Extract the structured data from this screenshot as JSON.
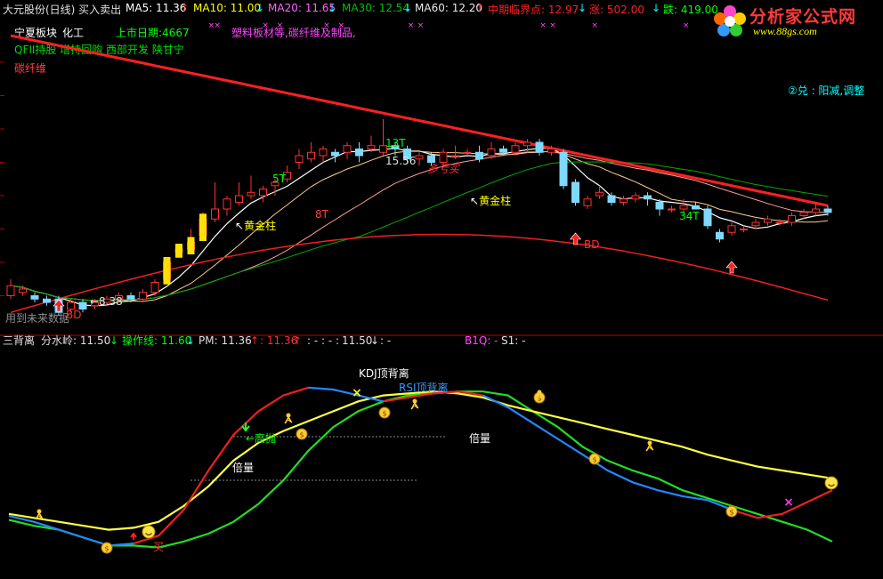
{
  "header": {
    "title": "大元股份(日线) 买入卖出",
    "ma5": "MA5: 11.36",
    "ma10": "MA10: 11.00",
    "ma20": "MA20: 11.65",
    "ma30": "MA30: 12.54",
    "ma60": "MA60: 12.20",
    "critical": "中期临界点: 12.97",
    "rise": "涨: 502.00",
    "fall": "跌: 419.00",
    "up_arrow": "↑",
    "down_arrow": "↓",
    "colors": {
      "ma5": "#ffffff",
      "ma10": "#ffff00",
      "ma20": "#ff66ff",
      "ma30": "#00ff00",
      "ma60": "#ff9999",
      "critical": "#ff2020"
    }
  },
  "logo": {
    "name": "分析家公式网",
    "url": "www.88gs.com"
  },
  "info": {
    "sector": "宁夏板块",
    "industry": "化工",
    "listing": "上市日期:4667",
    "product": "塑料板材等,碳纤维及制品,",
    "concepts": "QFII持股 增持回购 西部开发 陕甘宁",
    "concept2": "碳纤维",
    "right_note": "②兑 : 阳减,调整",
    "future_note": "用到未来数据"
  },
  "price_annotations": {
    "low": "←8.38",
    "high": "15.56",
    "t13": "13T",
    "t5": "5T",
    "t8": "8T",
    "t34": "34T",
    "duo": "多亏买",
    "golden1": "黄金柱",
    "golden2": "黄金柱",
    "bd1": "BD",
    "bd2": "BD"
  },
  "indicator": {
    "name": "三背离",
    "fenshui": "分水岭: 11.50",
    "caozuo": "操作线: 11.60",
    "pm": "PM: 11.36",
    "v1136": ": 11.36",
    "dashes": ": - : - :",
    "v1150": "11.50",
    "colon": ": -",
    "b1q": "B1Q: -",
    "s1": "S1: -",
    "kdj": "KDJ顶背离",
    "rsi": "RSI顶背离",
    "gaopao": "←高抛",
    "beiliang1": "倍量",
    "beiliang2": "倍量",
    "buy": "买"
  },
  "chart_data": [
    {
      "type": "candlestick",
      "title": "大元股份(日线)",
      "ylim": [
        8.0,
        16.8
      ],
      "series_notes": [
        "MA5",
        "MA10",
        "MA20",
        "MA30",
        "MA60",
        "中期临界点"
      ],
      "candles": [
        [
          9.0,
          9.3,
          9.5,
          8.9
        ],
        [
          9.1,
          9.2,
          9.3,
          9.0
        ],
        [
          9.0,
          8.9,
          9.1,
          8.8
        ],
        [
          8.9,
          8.8,
          9.0,
          8.7
        ],
        [
          8.9,
          8.5,
          9.0,
          8.4
        ],
        [
          8.6,
          8.8,
          8.9,
          8.5
        ],
        [
          8.8,
          8.6,
          8.9,
          8.5
        ],
        [
          8.7,
          8.8,
          8.9,
          8.6
        ],
        [
          8.8,
          8.9,
          9.0,
          8.7
        ],
        [
          8.9,
          9.0,
          9.1,
          8.8
        ],
        [
          9.0,
          8.9,
          9.1,
          8.8
        ],
        [
          8.9,
          9.1,
          9.2,
          8.8
        ],
        [
          9.1,
          9.4,
          9.5,
          9.0
        ],
        [
          9.5,
          10.0,
          10.1,
          9.4
        ],
        [
          10.3,
          10.4,
          10.5,
          10.2
        ],
        [
          10.4,
          10.6,
          11.0,
          10.3
        ],
        [
          10.8,
          11.3,
          11.5,
          10.7
        ],
        [
          11.3,
          11.6,
          12.4,
          11.2
        ],
        [
          11.6,
          11.9,
          12.0,
          11.4
        ],
        [
          11.8,
          12.0,
          12.4,
          11.7
        ],
        [
          12.0,
          12.1,
          12.6,
          11.9
        ],
        [
          12.0,
          12.2,
          12.3,
          11.8
        ],
        [
          12.3,
          12.4,
          12.5,
          12.0
        ],
        [
          12.5,
          12.7,
          12.9,
          12.4
        ],
        [
          13.0,
          13.2,
          13.4,
          12.8
        ],
        [
          13.1,
          13.3,
          13.6,
          13.0
        ],
        [
          13.2,
          13.4,
          13.5,
          13.0
        ],
        [
          13.3,
          13.2,
          13.4,
          13.0
        ],
        [
          13.3,
          13.5,
          13.6,
          13.1
        ],
        [
          13.4,
          13.2,
          13.6,
          13.0
        ],
        [
          13.4,
          13.5,
          13.8,
          13.3
        ],
        [
          13.3,
          13.5,
          14.3,
          13.2
        ],
        [
          13.5,
          13.4,
          13.6,
          13.2
        ],
        [
          13.4,
          13.1,
          13.5,
          13.0
        ],
        [
          13.1,
          13.2,
          13.3,
          12.9
        ],
        [
          13.2,
          13.0,
          13.3,
          12.9
        ],
        [
          13.0,
          13.3,
          13.4,
          12.9
        ],
        [
          13.2,
          13.2,
          13.5,
          13.1
        ],
        [
          13.3,
          13.3,
          13.4,
          13.2
        ],
        [
          13.3,
          13.1,
          13.5,
          13.0
        ],
        [
          13.2,
          13.4,
          13.6,
          13.1
        ],
        [
          13.4,
          13.3,
          13.5,
          13.2
        ],
        [
          13.3,
          13.5,
          13.6,
          13.2
        ],
        [
          13.5,
          13.6,
          13.7,
          13.3
        ],
        [
          13.6,
          13.3,
          13.7,
          13.2
        ],
        [
          13.3,
          13.4,
          13.5,
          13.2
        ],
        [
          13.3,
          12.3,
          13.4,
          12.2
        ],
        [
          12.4,
          11.8,
          12.5,
          11.7
        ],
        [
          11.7,
          11.9,
          12.0,
          11.6
        ],
        [
          12.0,
          12.1,
          12.3,
          11.9
        ],
        [
          12.0,
          11.8,
          12.1,
          11.7
        ],
        [
          11.8,
          11.9,
          12.0,
          11.7
        ],
        [
          11.9,
          12.0,
          12.1,
          11.8
        ],
        [
          12.0,
          11.9,
          12.1,
          11.7
        ],
        [
          11.8,
          11.6,
          11.9,
          11.4
        ],
        [
          11.6,
          11.6,
          11.7,
          11.5
        ],
        [
          11.6,
          11.7,
          11.9,
          11.5
        ],
        [
          11.7,
          11.6,
          11.8,
          11.6
        ],
        [
          11.6,
          11.1,
          11.7,
          11.0
        ],
        [
          10.9,
          10.7,
          11.0,
          10.6
        ],
        [
          10.9,
          11.1,
          11.2,
          10.8
        ],
        [
          11.0,
          11.0,
          11.1,
          10.9
        ],
        [
          11.1,
          11.2,
          11.3,
          11.0
        ],
        [
          11.2,
          11.3,
          11.4,
          11.1
        ],
        [
          11.2,
          11.2,
          11.3,
          11.1
        ],
        [
          11.2,
          11.4,
          11.5,
          11.1
        ],
        [
          11.4,
          11.5,
          11.6,
          11.3
        ],
        [
          11.5,
          11.6,
          11.8,
          11.4
        ],
        [
          11.6,
          11.5,
          11.7,
          11.4
        ]
      ]
    },
    {
      "type": "line",
      "title": "三背离",
      "ylim": [
        0,
        100
      ],
      "series": [
        {
          "name": "green",
          "values": [
            25,
            22,
            20,
            16,
            12,
            12,
            11,
            14,
            18,
            24,
            33,
            45,
            60,
            72,
            80,
            85,
            88,
            89,
            90,
            90,
            88,
            80,
            72,
            62,
            55,
            50,
            46,
            40,
            36,
            32,
            28,
            24,
            20,
            14
          ]
        },
        {
          "name": "yellow",
          "values": [
            28,
            26,
            24,
            22,
            20,
            21,
            24,
            32,
            42,
            55,
            64,
            70,
            75,
            80,
            85,
            88,
            89,
            90,
            89,
            87,
            83,
            80,
            77,
            74,
            71,
            68,
            65,
            62,
            58,
            55,
            52,
            50,
            48,
            46
          ]
        },
        {
          "name": "red_blue",
          "values": [
            27,
            24,
            20,
            16,
            12,
            13,
            17,
            30,
            50,
            68,
            80,
            88,
            92,
            91,
            88,
            85,
            87,
            89,
            90,
            88,
            82,
            74,
            66,
            58,
            50,
            44,
            40,
            37,
            35,
            30,
            26,
            28,
            34,
            40
          ]
        }
      ]
    }
  ]
}
